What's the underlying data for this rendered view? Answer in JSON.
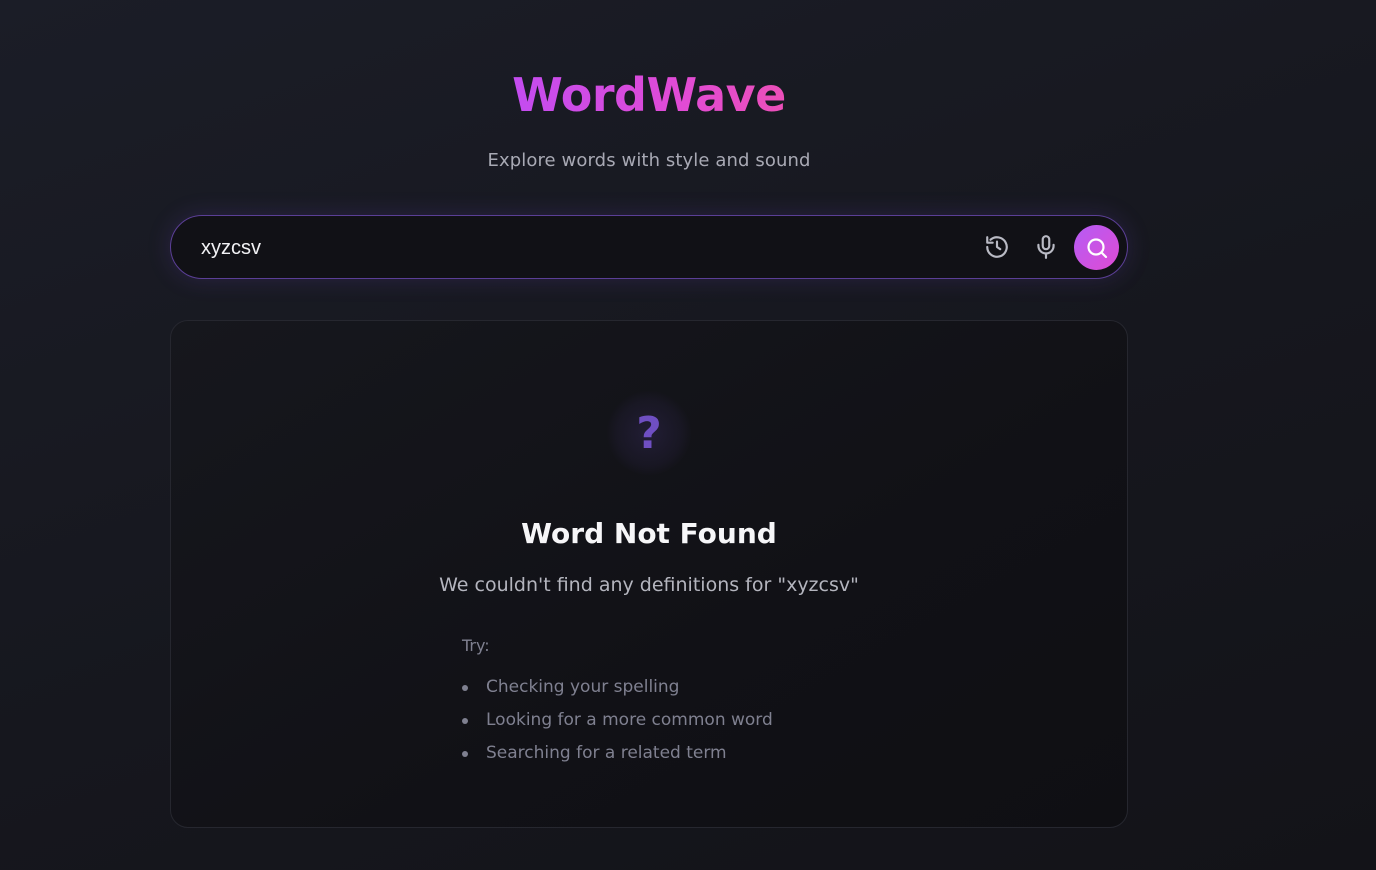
{
  "header": {
    "title": "WordWave",
    "subtitle": "Explore words with style and sound"
  },
  "search": {
    "value": "xyzcsv",
    "icons": {
      "history": "history-icon",
      "mic": "microphone-icon",
      "search": "search-icon"
    }
  },
  "result": {
    "icon": "question-mark-icon",
    "icon_glyph": "?",
    "title": "Word Not Found",
    "message": "We couldn't find any definitions for \"xyzcsv\"",
    "try_label": "Try:",
    "suggestions": [
      "Checking your spelling",
      "Looking for a more common word",
      "Searching for a related term"
    ]
  },
  "colors": {
    "accent_start": "#c34cf0",
    "accent_end": "#ec4fb8",
    "question_mark": "#6f4fc2",
    "search_border": "#5b3f96"
  }
}
